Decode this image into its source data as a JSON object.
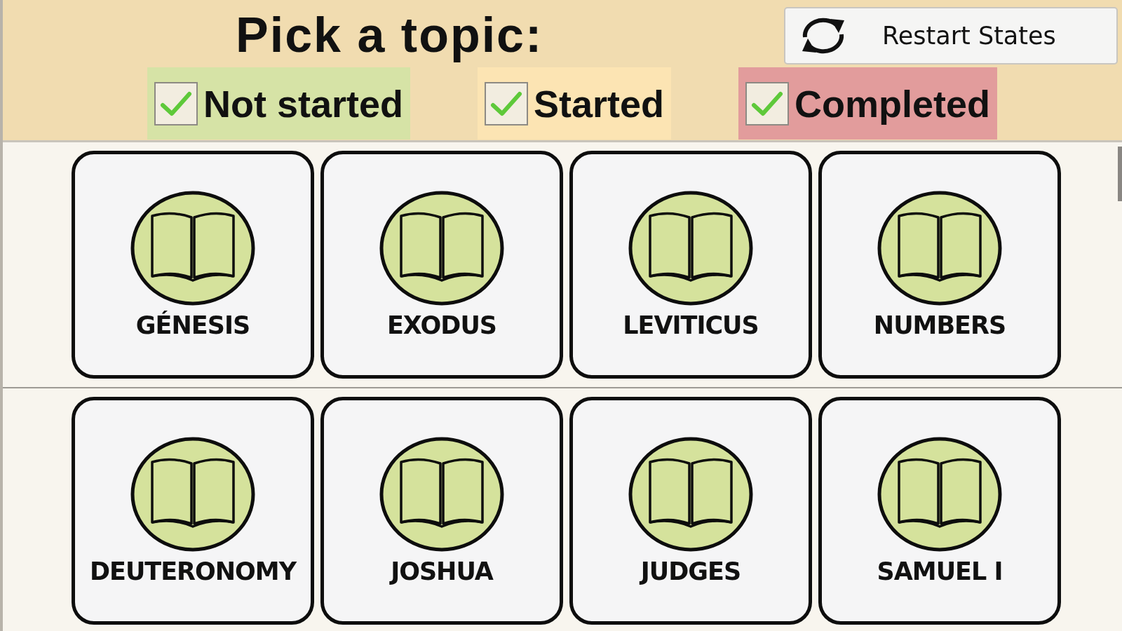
{
  "title": "Pick a topic:",
  "restart_button": {
    "label": "Restart States"
  },
  "filters": [
    {
      "label": "Not started",
      "checked": true,
      "color": "#d6e3a6"
    },
    {
      "label": "Started",
      "checked": true,
      "color": "#fce4b3"
    },
    {
      "label": "Completed",
      "checked": true,
      "color": "#e29c9c"
    }
  ],
  "topic_rows": [
    {
      "topics": [
        {
          "label": "GÉNESIS"
        },
        {
          "label": "EXODUS"
        },
        {
          "label": "LEVITICUS"
        },
        {
          "label": "NUMBERS"
        }
      ]
    },
    {
      "topics": [
        {
          "label": "DEUTERONOMY"
        },
        {
          "label": "JOSHUA"
        },
        {
          "label": "JUDGES"
        },
        {
          "label": "SAMUEL I"
        }
      ]
    }
  ]
}
